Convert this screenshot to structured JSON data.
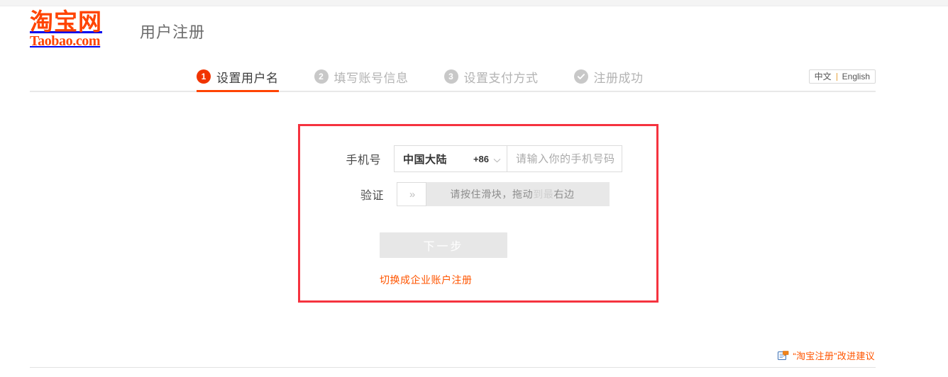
{
  "site": {
    "logo_cn": "淘宝网",
    "logo_en": "Taobao.com",
    "page_title": "用户注册",
    "brand_color": "#ff4400"
  },
  "steps": [
    {
      "number": "1",
      "label": "设置用户名",
      "state": "active"
    },
    {
      "number": "2",
      "label": "填写账号信息",
      "state": "inactive"
    },
    {
      "number": "3",
      "label": "设置支付方式",
      "state": "inactive"
    },
    {
      "number": "✓",
      "label": "注册成功",
      "state": "inactive"
    }
  ],
  "language": {
    "chinese": "中文",
    "english": "English",
    "selected": "中文"
  },
  "form": {
    "phone": {
      "label": "手机号",
      "country_name": "中国大陆",
      "country_code": "+86",
      "input_value": "",
      "input_placeholder": "请输入你的手机号码"
    },
    "verify": {
      "label": "验证",
      "handle_icon": "double-chevron-right",
      "slider_text_main": "请按住滑块，拖动",
      "slider_text_faded": "到最",
      "slider_text_tail": "右边"
    },
    "next_button": "下一步",
    "switch_link": "切换成企业账户注册"
  },
  "footer": {
    "feedback_icon": "feedback-note-icon",
    "feedback_text": "“淘宝注册”改进建议"
  },
  "colors": {
    "accent_orange": "#ff4400",
    "link_orange": "#ff5500",
    "annotation_red": "#f5333f",
    "step_inactive_gray": "#c8c8c8",
    "disabled_button": "#e7e7e7"
  }
}
